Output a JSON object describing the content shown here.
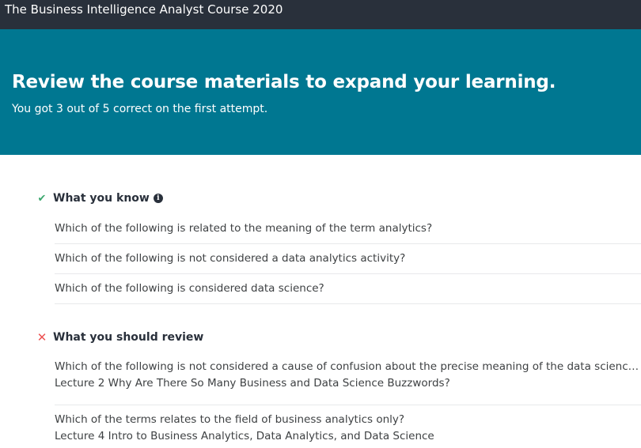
{
  "app": {
    "title": "The Business Intelligence Analyst Course 2020"
  },
  "banner": {
    "heading": "Review the course materials to expand your learning.",
    "result": "You got 3 out of 5 correct on the first attempt."
  },
  "know": {
    "title": "What you know",
    "icon": "check-icon",
    "info_icon": "info-icon",
    "items": [
      "Which of the following is related to the meaning of the term analytics?",
      "Which of the following is not considered a data analytics activity?",
      "Which of the following is considered data science?"
    ]
  },
  "review": {
    "title": "What you should review",
    "icon": "cross-icon",
    "items": [
      {
        "question": "Which of the following is not considered a cause of confusion about the precise meaning of the data science field?",
        "lecture": "Lecture 2 Why Are There So Many Business and Data Science Buzzwords?"
      },
      {
        "question": "Which of the terms relates to the field of business analytics only?",
        "lecture": "Lecture 4 Intro to Business Analytics, Data Analytics, and Data Science"
      }
    ]
  },
  "colors": {
    "topbar": "#29303b",
    "banner": "#007791",
    "success": "#3aa76d",
    "error": "#ec5252"
  }
}
